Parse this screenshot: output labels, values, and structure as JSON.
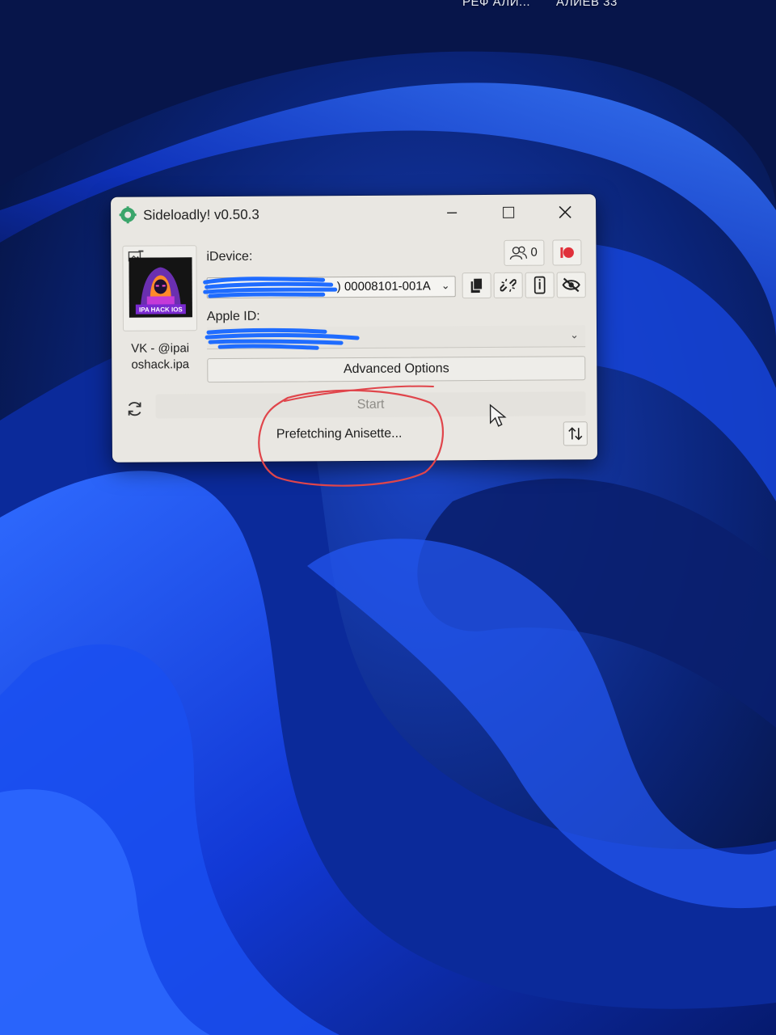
{
  "desktop": {
    "labels": [
      "РЕФ АЛИ...",
      "АЛИЕВ 33"
    ]
  },
  "window": {
    "title": "Sideloadly! v0.50.3",
    "controls": {
      "minimize_icon": "minimize-icon",
      "maximize_icon": "maximize-icon",
      "close_icon": "close-icon"
    }
  },
  "app_panel": {
    "caption": "VK - @ipaioshack.ipa",
    "caption_line1": "VK - @ipai",
    "caption_line2": "oshack.ipa",
    "avatar_text": "IPA HACK IOS"
  },
  "idevice": {
    "label": "iDevice:",
    "selected_value": ") 00008101-001A",
    "counter_value": "0"
  },
  "apple_id": {
    "label": "Apple ID:"
  },
  "buttons": {
    "advanced_options": "Advanced Options",
    "start": "Start"
  },
  "status": {
    "text": "Prefetching Anisette..."
  },
  "colors": {
    "window_bg": "#e9e7e2",
    "record_red": "#e0303a",
    "scribble_blue": "#1f6cff",
    "annotation_red": "#e0454b"
  }
}
